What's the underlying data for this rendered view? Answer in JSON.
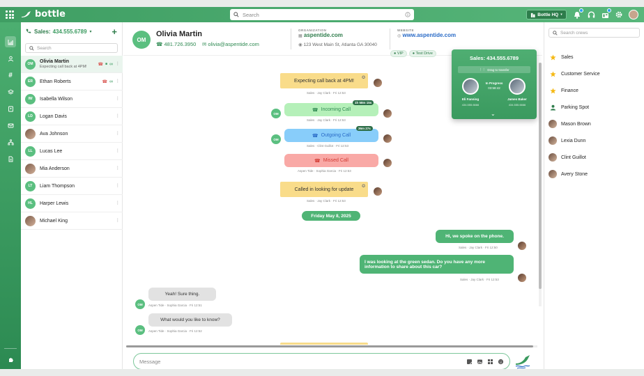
{
  "app": {
    "brand": "bottle",
    "search_placeholder": "Search",
    "workspace": "Bottle HQ"
  },
  "contacts": {
    "header_label": "Sales:",
    "header_number": "434.555.6789",
    "search_placeholder": "Search",
    "items": [
      {
        "initials": "OM",
        "name": "Olivia Martin",
        "sub": "Expecting call back at 4PM!",
        "photo": false
      },
      {
        "initials": "ER",
        "name": "Ethan Roberts",
        "sub": "",
        "photo": false
      },
      {
        "initials": "IW",
        "name": "Isabella Wilson",
        "sub": "",
        "photo": false
      },
      {
        "initials": "LD",
        "name": "Logan Davis",
        "sub": "",
        "photo": false
      },
      {
        "initials": "",
        "name": "Ava Johnson",
        "sub": "",
        "photo": true
      },
      {
        "initials": "LL",
        "name": "Lucas Lee",
        "sub": "",
        "photo": false
      },
      {
        "initials": "",
        "name": "Mia Anderson",
        "sub": "",
        "photo": true
      },
      {
        "initials": "LT",
        "name": "Liam Thompson",
        "sub": "",
        "photo": false
      },
      {
        "initials": "HL",
        "name": "Harper Lewis",
        "sub": "",
        "photo": false
      },
      {
        "initials": "",
        "name": "Michael King",
        "sub": "",
        "photo": true
      }
    ]
  },
  "contact": {
    "initials": "OM",
    "name": "Olivia Martin",
    "phone": "481.726.3950",
    "email": "olivia@aspentide.com",
    "org_label": "ORGANIZATION",
    "org": "aspentide.com",
    "address": "123 West Main St, Atlanta GA 30040",
    "website_label": "WEBSITE",
    "website": "www.aspentide.com",
    "tags": [
      "VIP",
      "Test Drive"
    ]
  },
  "messages": {
    "note1": "Expecting call back at 4PM!",
    "note1_meta": "Sales · Jay Clark · Fri 12:53",
    "incoming": "Incoming Call",
    "incoming_dur": "1h 58m 15s",
    "incoming_meta": "Sales · Jay Clark · Fri 12:53",
    "outgoing": "Outgoing Call",
    "outgoing_dur": "36m 27s",
    "outgoing_meta": "Sales · Clint Guillot · Fri 12:53",
    "missed": "Missed Call",
    "missed_meta": "Aspen Tide · Sophia Garcia · Fri 12:53",
    "note2": "Called in looking for update",
    "note2_meta": "Sales · Jay Clark · Fri 12:53",
    "day": "Friday May 8, 2025",
    "out1": "Hi, we spoke on the phone.",
    "out1_meta": "Sales · Jay Clark · Fri 12:50",
    "out2_line1": "I was looking at the green sedan. Do you have any more",
    "out2_line2": "information to share about this car?",
    "out2_meta": "Sales · Jay Clark · Fri 12:53",
    "in1": "Yeah! Sure thing.",
    "in1_meta": "Aspen Tide · Sophia Garcia · Fri 12:51",
    "in2": "What would you like to know?",
    "in2_meta": "Aspen Tide · Sophia Garcia · Fri 12:52",
    "avatar_initials": "OM"
  },
  "composer": {
    "placeholder": "Message"
  },
  "transfer": {
    "title": "Sales: 434.555.6789",
    "drag_label": "Drag to transfer",
    "status": "In Progress",
    "timer": "03:58:42",
    "left_name": "Eli Fanning",
    "left_number": "434.555.6666",
    "right_name": "James Baker",
    "right_number": "434.555.6666"
  },
  "crews": {
    "search_placeholder": "Search crews",
    "items": [
      {
        "name": "Sales",
        "icon": "star-icon"
      },
      {
        "name": "Customer Service",
        "icon": "star-icon"
      },
      {
        "name": "Finance",
        "icon": "star-icon"
      },
      {
        "name": "Parking Spot",
        "icon": "person-icon"
      },
      {
        "name": "Mason Brown",
        "icon": "avatar"
      },
      {
        "name": "Lexia Dunn",
        "icon": "avatar"
      },
      {
        "name": "Clint Guillot",
        "icon": "avatar"
      },
      {
        "name": "Avery Stone",
        "icon": "avatar"
      }
    ]
  },
  "colors": {
    "brand_green": "#4fb475",
    "note_yellow": "#f9dc8a",
    "incoming_green": "#b5f0b9",
    "outgoing_blue": "#88cdfa",
    "missed_red": "#f9a9a6",
    "inbound_gray": "#e2e2e2"
  }
}
